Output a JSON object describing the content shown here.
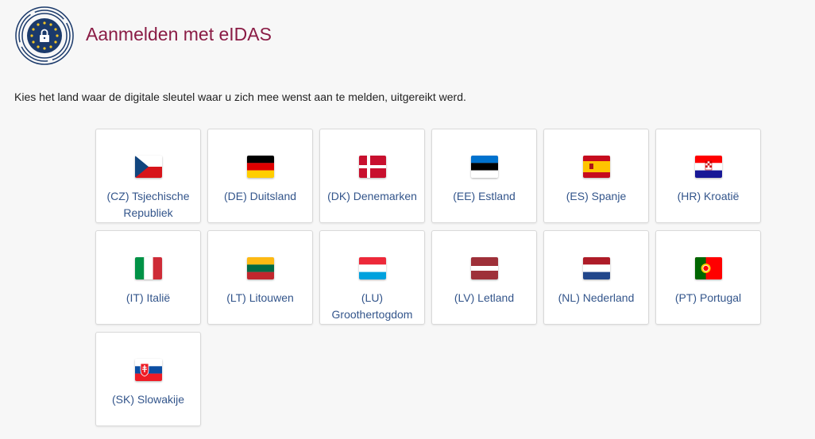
{
  "header": {
    "title": "Aanmelden met eIDAS",
    "logo_icon": "eidas-lock-logo-icon"
  },
  "intro": "Kies het land waar de digitale sleutel waar u zich mee wenst aan te melden, uitgereikt werd.",
  "countries": [
    {
      "code": "cz",
      "label": "(CZ) Tsjechische Republiek",
      "flag_icon": "czech-flag-icon"
    },
    {
      "code": "de",
      "label": "(DE) Duitsland",
      "flag_icon": "german-flag-icon"
    },
    {
      "code": "dk",
      "label": "(DK) Denemarken",
      "flag_icon": "danish-flag-icon"
    },
    {
      "code": "ee",
      "label": "(EE) Estland",
      "flag_icon": "estonian-flag-icon"
    },
    {
      "code": "es",
      "label": "(ES) Spanje",
      "flag_icon": "spanish-flag-icon"
    },
    {
      "code": "hr",
      "label": "(HR) Kroatië",
      "flag_icon": "croatian-flag-icon"
    },
    {
      "code": "it",
      "label": "(IT) Italië",
      "flag_icon": "italian-flag-icon"
    },
    {
      "code": "lt",
      "label": "(LT) Litouwen",
      "flag_icon": "lithuanian-flag-icon"
    },
    {
      "code": "lu",
      "label": "(LU) Groothertogdom",
      "flag_icon": "luxembourg-flag-icon"
    },
    {
      "code": "lv",
      "label": "(LV) Letland",
      "flag_icon": "latvian-flag-icon"
    },
    {
      "code": "nl",
      "label": "(NL) Nederland",
      "flag_icon": "dutch-flag-icon"
    },
    {
      "code": "pt",
      "label": "(PT) Portugal",
      "flag_icon": "portuguese-flag-icon"
    },
    {
      "code": "sk",
      "label": "(SK) Slowakije",
      "flag_icon": "slovak-flag-icon"
    }
  ],
  "colors": {
    "title": "#8a1c45",
    "link": "#33558b",
    "background": "#f7f7f7"
  }
}
